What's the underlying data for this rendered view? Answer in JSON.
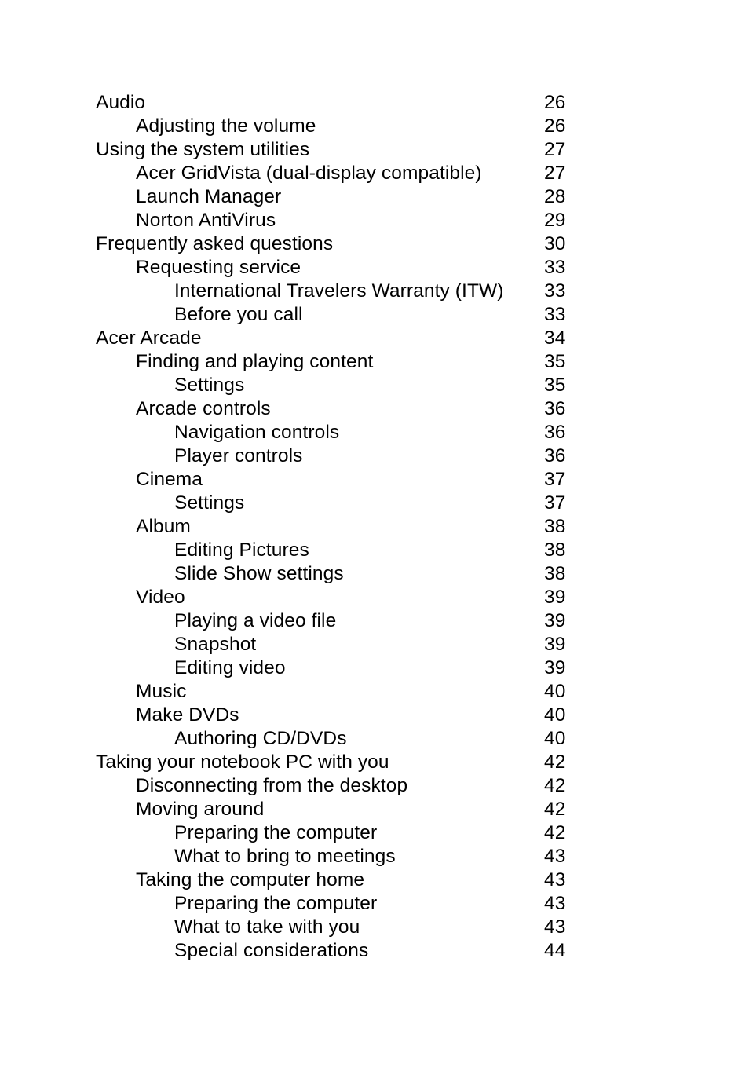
{
  "document": {
    "type": "table-of-contents",
    "page_background": "#ffffff",
    "text_color": "#000000"
  },
  "toc": {
    "entries": [
      {
        "title": "Audio",
        "page": "26",
        "level": 0
      },
      {
        "title": "Adjusting the volume",
        "page": "26",
        "level": 1
      },
      {
        "title": "Using the system utilities",
        "page": "27",
        "level": 0
      },
      {
        "title": "Acer GridVista (dual-display compatible)",
        "page": "27",
        "level": 1
      },
      {
        "title": "Launch Manager",
        "page": "28",
        "level": 1
      },
      {
        "title": "Norton AntiVirus",
        "page": "29",
        "level": 1
      },
      {
        "title": "Frequently asked questions",
        "page": "30",
        "level": 0
      },
      {
        "title": "Requesting service",
        "page": "33",
        "level": 1
      },
      {
        "title": "International Travelers Warranty (ITW)",
        "page": "33",
        "level": 2
      },
      {
        "title": "Before you call",
        "page": "33",
        "level": 2
      },
      {
        "title": "Acer Arcade",
        "page": "34",
        "level": 0
      },
      {
        "title": "Finding and playing content",
        "page": "35",
        "level": 1
      },
      {
        "title": "Settings",
        "page": "35",
        "level": 2
      },
      {
        "title": "Arcade controls",
        "page": "36",
        "level": 1
      },
      {
        "title": "Navigation controls",
        "page": "36",
        "level": 2
      },
      {
        "title": "Player controls",
        "page": "36",
        "level": 2
      },
      {
        "title": "Cinema",
        "page": "37",
        "level": 1
      },
      {
        "title": "Settings",
        "page": "37",
        "level": 2
      },
      {
        "title": "Album",
        "page": "38",
        "level": 1
      },
      {
        "title": "Editing Pictures",
        "page": "38",
        "level": 2
      },
      {
        "title": "Slide Show settings",
        "page": "38",
        "level": 2
      },
      {
        "title": "Video",
        "page": "39",
        "level": 1
      },
      {
        "title": "Playing a video file",
        "page": "39",
        "level": 2
      },
      {
        "title": "Snapshot",
        "page": "39",
        "level": 2
      },
      {
        "title": "Editing video",
        "page": "39",
        "level": 2
      },
      {
        "title": "Music",
        "page": "40",
        "level": 1
      },
      {
        "title": "Make DVDs",
        "page": "40",
        "level": 1
      },
      {
        "title": "Authoring CD/DVDs",
        "page": "40",
        "level": 2
      },
      {
        "title": "Taking your notebook PC with you",
        "page": "42",
        "level": 0
      },
      {
        "title": "Disconnecting from the desktop",
        "page": "42",
        "level": 1
      },
      {
        "title": "Moving around",
        "page": "42",
        "level": 1
      },
      {
        "title": "Preparing the computer",
        "page": "42",
        "level": 2
      },
      {
        "title": "What to bring to meetings",
        "page": "43",
        "level": 2
      },
      {
        "title": "Taking the computer home",
        "page": "43",
        "level": 1
      },
      {
        "title": "Preparing the computer",
        "page": "43",
        "level": 2
      },
      {
        "title": "What to take with you",
        "page": "43",
        "level": 2
      },
      {
        "title": "Special considerations",
        "page": "44",
        "level": 2
      }
    ]
  }
}
